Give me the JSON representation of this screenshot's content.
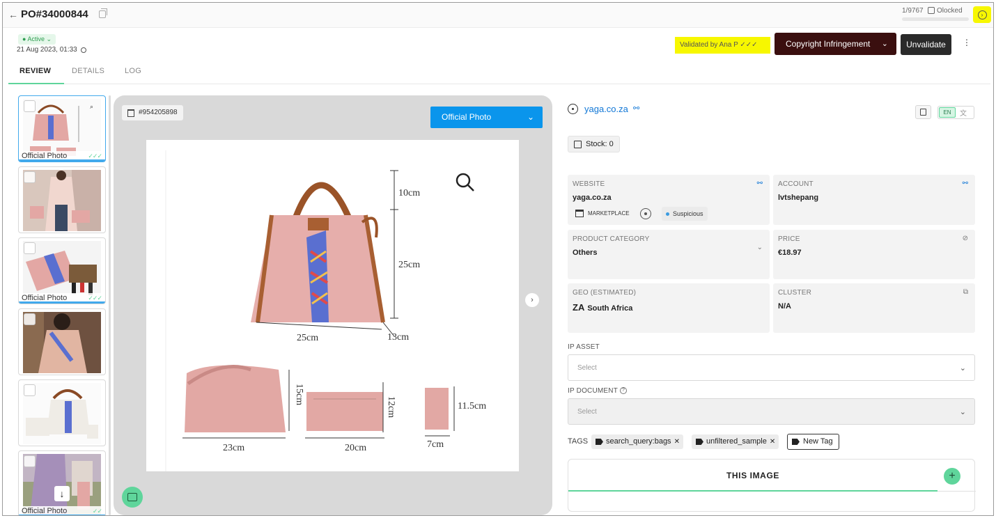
{
  "topbar": {
    "back_icon": "arrow-left-icon",
    "po_number": "PO#34000844",
    "counter": "1/9767",
    "clocked": "Olocked",
    "progress_fraction": 0.0001
  },
  "header": {
    "status": "● Active ⌄",
    "datetime": "21 Aug 2023, 01:33",
    "validated_by": "Validated by Ana P ✓✓✓",
    "verdict_label": "Copyright Infringement",
    "unvalidate_label": "Unvalidate",
    "highlight_color": "#f7f700",
    "verdict_color": "#3a0f0f"
  },
  "tabs": [
    {
      "label": "REVIEW",
      "active": true
    },
    {
      "label": "DETAILS",
      "active": false
    },
    {
      "label": "LOG",
      "active": false
    }
  ],
  "thumbnails": [
    {
      "caption": "Official Photo",
      "ticks": "✓✓✓",
      "selected": true
    },
    {
      "caption": "",
      "ticks": "",
      "selected": false
    },
    {
      "caption": "Official Photo",
      "ticks": "✓✓✓",
      "selected": false
    },
    {
      "caption": "",
      "ticks": "",
      "selected": false
    },
    {
      "caption": "",
      "ticks": "",
      "selected": false
    },
    {
      "caption": "Official Photo",
      "ticks": "✓✓",
      "selected": false
    }
  ],
  "viewer": {
    "image_id": "#954205898",
    "photo_type": "Official Photo",
    "dimensions": {
      "height_bag": "10cm",
      "height_body": "25cm",
      "width_bag": "25cm",
      "depth_bag": "13cm",
      "shoulder_width": "23cm",
      "shoulder_height": "15cm",
      "clutch_width": "20cm",
      "clutch_height": "12cm",
      "wallet_width": "7cm",
      "wallet_height": "11.5cm"
    }
  },
  "listing": {
    "site": "yaga.co.za",
    "stock": "Stock: 0",
    "lang": "EN",
    "translate_glyph": "文",
    "website_label": "WEBSITE",
    "website_value": "yaga.co.za",
    "marketplace_label": "MARKETPLACE",
    "risk_label": "Suspicious",
    "account_label": "ACCOUNT",
    "account_value": "lvtshepang",
    "category_label": "PRODUCT CATEGORY",
    "category_value": "Others",
    "price_label": "PRICE",
    "price_value": "€18.97",
    "geo_label": "GEO (ESTIMATED)",
    "geo_code": "ZA",
    "geo_value": "South Africa",
    "cluster_label": "CLUSTER",
    "cluster_value": "N/A",
    "ip_asset_label": "IP ASSET",
    "ip_asset_placeholder": "Select",
    "ip_document_label": "IP DOCUMENT",
    "ip_document_placeholder": "Select",
    "tags_label": "TAGS",
    "tags": [
      "search_query:bags",
      "unfiltered_sample"
    ],
    "new_tag_label": "New Tag",
    "image_panel_title": "THIS IMAGE",
    "accent_color": "#5fd59b",
    "link_color": "#1177d6"
  }
}
